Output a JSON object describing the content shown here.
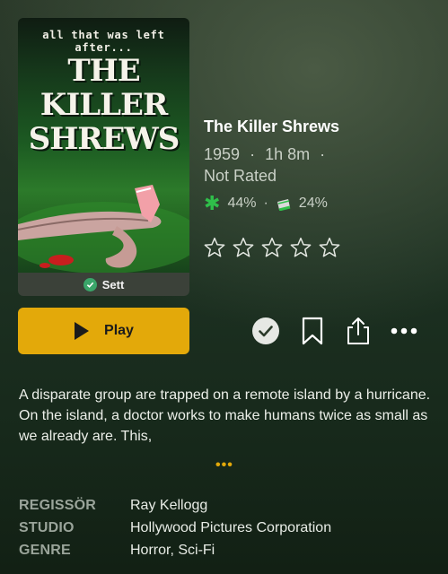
{
  "poster": {
    "tagline": "all that was left after...",
    "title_lines": [
      "THE",
      "KILLER",
      "SHREWS"
    ],
    "watched_label": "Sett"
  },
  "movie": {
    "title": "The Killer Shrews",
    "year": "1959",
    "runtime": "1h 8m",
    "rating_label": "Not Rated",
    "critic_score": "44%",
    "audience_score": "24%",
    "user_stars": 0,
    "separator": "·"
  },
  "actions": {
    "play_label": "Play"
  },
  "description": {
    "text": "A disparate group are trapped on a remote island by a hurricane. On the island, a doctor works to make humans twice as small as we already are. This,",
    "more": "•••"
  },
  "credits": [
    {
      "key": "REGISSÖR",
      "value": "Ray Kellogg"
    },
    {
      "key": "STUDIO",
      "value": "Hollywood Pictures Corporation"
    },
    {
      "key": "GENRE",
      "value": "Horror, Sci-Fi"
    }
  ],
  "colors": {
    "accent": "#e3a90a",
    "watched_green": "#3aa66a",
    "critic_green": "#2fbf4a"
  }
}
